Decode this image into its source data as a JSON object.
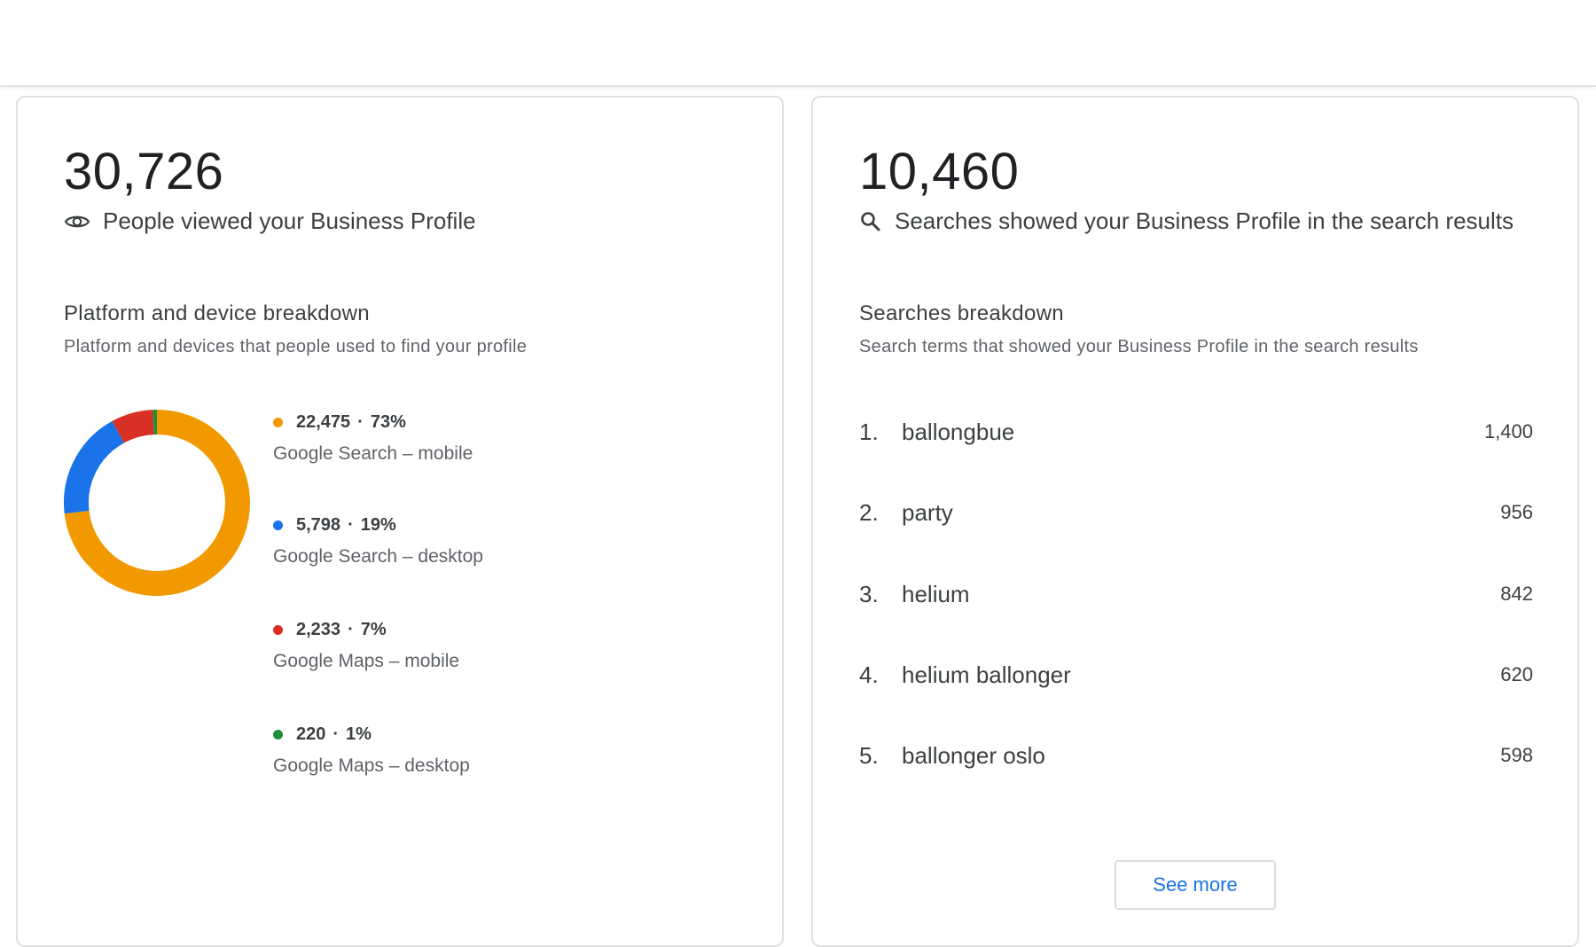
{
  "views_card": {
    "total": "30,726",
    "metric_label": "People viewed your Business Profile",
    "section_title": "Platform and device breakdown",
    "section_subtitle": "Platform and devices that people used to find your profile",
    "breakdown": [
      {
        "value": "22,475",
        "percent": "73%",
        "label": "Google Search – mobile",
        "color": "#f29900"
      },
      {
        "value": "5,798",
        "percent": "19%",
        "label": "Google Search – desktop",
        "color": "#1a73e8"
      },
      {
        "value": "2,233",
        "percent": "7%",
        "label": "Google Maps – mobile",
        "color": "#d93025"
      },
      {
        "value": "220",
        "percent": "1%",
        "label": "Google Maps – desktop",
        "color": "#1e8e3e"
      }
    ],
    "separator": "·"
  },
  "searches_card": {
    "total": "10,460",
    "metric_label": "Searches showed your Business Profile in the search results",
    "section_title": "Searches breakdown",
    "section_subtitle": "Search terms that showed your Business Profile in the search results",
    "terms": [
      {
        "rank": "1.",
        "term": "ballongbue",
        "count": "1,400"
      },
      {
        "rank": "2.",
        "term": "party",
        "count": "956"
      },
      {
        "rank": "3.",
        "term": "helium",
        "count": "842"
      },
      {
        "rank": "4.",
        "term": "helium ballonger",
        "count": "620"
      },
      {
        "rank": "5.",
        "term": "ballonger oslo",
        "count": "598"
      }
    ],
    "see_more_label": "See more"
  },
  "chart_data": {
    "type": "pie",
    "donut": true,
    "categories": [
      "Google Search – mobile",
      "Google Search – desktop",
      "Google Maps – mobile",
      "Google Maps – desktop"
    ],
    "values": [
      22475,
      5798,
      2233,
      220
    ],
    "percentages": [
      73,
      19,
      7,
      1
    ],
    "colors": [
      "#f29900",
      "#1a73e8",
      "#d93025",
      "#1e8e3e"
    ]
  }
}
